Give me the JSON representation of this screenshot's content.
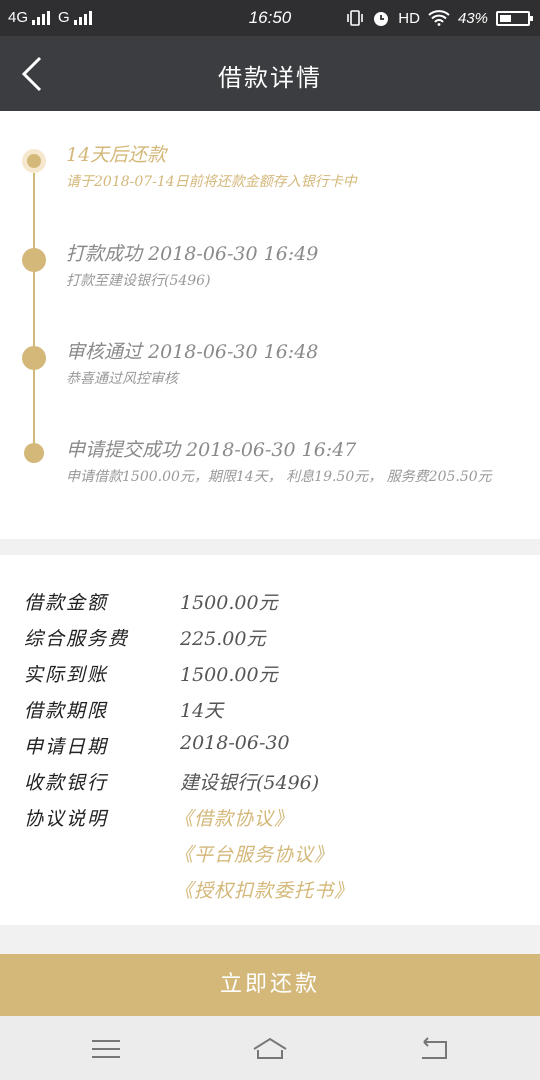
{
  "status_bar": {
    "network1": "4G",
    "network2": "G",
    "time": "16:50",
    "hd": "HD",
    "battery": "43%",
    "battery_level": 0.43
  },
  "header": {
    "title": "借款详情"
  },
  "timeline": [
    {
      "title": "14天后还款",
      "subtitle": "请于2018-07-14日前将还款金额存入银行卡中",
      "active": true
    },
    {
      "title": "打款成功 2018-06-30 16:49",
      "subtitle": "打款至建设银行(5496)",
      "active": false
    },
    {
      "title": "审核通过 2018-06-30 16:48",
      "subtitle": "恭喜通过风控审核",
      "active": false
    },
    {
      "title": "申请提交成功 2018-06-30 16:47",
      "subtitle": "申请借款1500.00元，期限14天， 利息19.50元， 服务费205.50元",
      "active": false
    }
  ],
  "details": [
    {
      "label": "借款金额",
      "value": "1500.00元"
    },
    {
      "label": "综合服务费",
      "value": "225.00元"
    },
    {
      "label": "实际到账",
      "value": "1500.00元"
    },
    {
      "label": "借款期限",
      "value": "14天"
    },
    {
      "label": "申请日期",
      "value": "2018-06-30"
    },
    {
      "label": "收款银行",
      "value": "建设银行(5496)"
    },
    {
      "label": "协议说明",
      "value": ""
    }
  ],
  "agreements": [
    "《借款协议》",
    "《平台服务协议》",
    "《授权扣款委托书》"
  ],
  "repay_button": "立即还款",
  "colors": {
    "accent": "#d4b87a",
    "header_bg": "#3b3d41",
    "status_bg": "#2f2f31"
  }
}
